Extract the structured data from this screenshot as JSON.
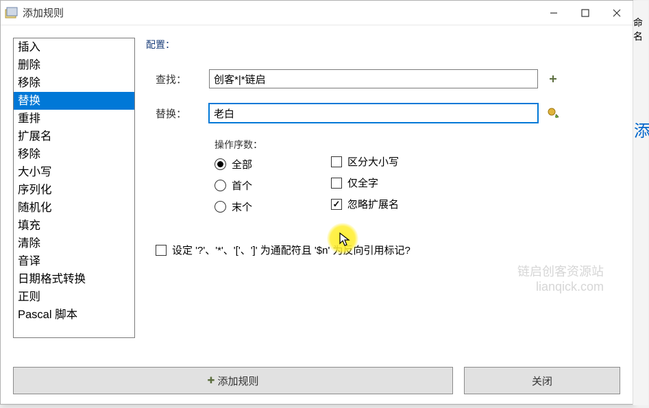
{
  "window": {
    "title": "添加规则"
  },
  "sidebar": [
    {
      "label": "插入",
      "selected": false
    },
    {
      "label": "删除",
      "selected": false
    },
    {
      "label": "移除",
      "selected": false
    },
    {
      "label": "替换",
      "selected": true
    },
    {
      "label": "重排",
      "selected": false
    },
    {
      "label": "扩展名",
      "selected": false
    },
    {
      "label": "移除",
      "selected": false
    },
    {
      "label": "大小写",
      "selected": false
    },
    {
      "label": "序列化",
      "selected": false
    },
    {
      "label": "随机化",
      "selected": false
    },
    {
      "label": "填充",
      "selected": false
    },
    {
      "label": "清除",
      "selected": false
    },
    {
      "label": "音译",
      "selected": false
    },
    {
      "label": "日期格式转换",
      "selected": false
    },
    {
      "label": "正则",
      "selected": false
    },
    {
      "label": "Pascal 脚本",
      "selected": false
    }
  ],
  "config": {
    "section_label": "配置：",
    "find_label": "查找：",
    "find_value": "创客*|*链启",
    "replace_label": "替换：",
    "replace_value": "老白",
    "occurrences_label": "操作序数：",
    "occurrences": [
      {
        "label": "全部",
        "checked": true
      },
      {
        "label": "首个",
        "checked": false
      },
      {
        "label": "末个",
        "checked": false
      }
    ],
    "options": [
      {
        "label": "区分大小写",
        "checked": false
      },
      {
        "label": "仅全字",
        "checked": false
      },
      {
        "label": "忽略扩展名",
        "checked": true
      }
    ],
    "wildcard_label": "设定 '?'、'*'、'['、']' 为通配符且 '$n' 为反向引用标记?",
    "wildcard_checked": false
  },
  "buttons": {
    "add": "添加规则",
    "close": "关闭"
  },
  "watermark": {
    "line1": "链启创客资源站",
    "line2": "lianqick.com"
  },
  "bg": {
    "corner1": "命名",
    "corner2": "添"
  }
}
